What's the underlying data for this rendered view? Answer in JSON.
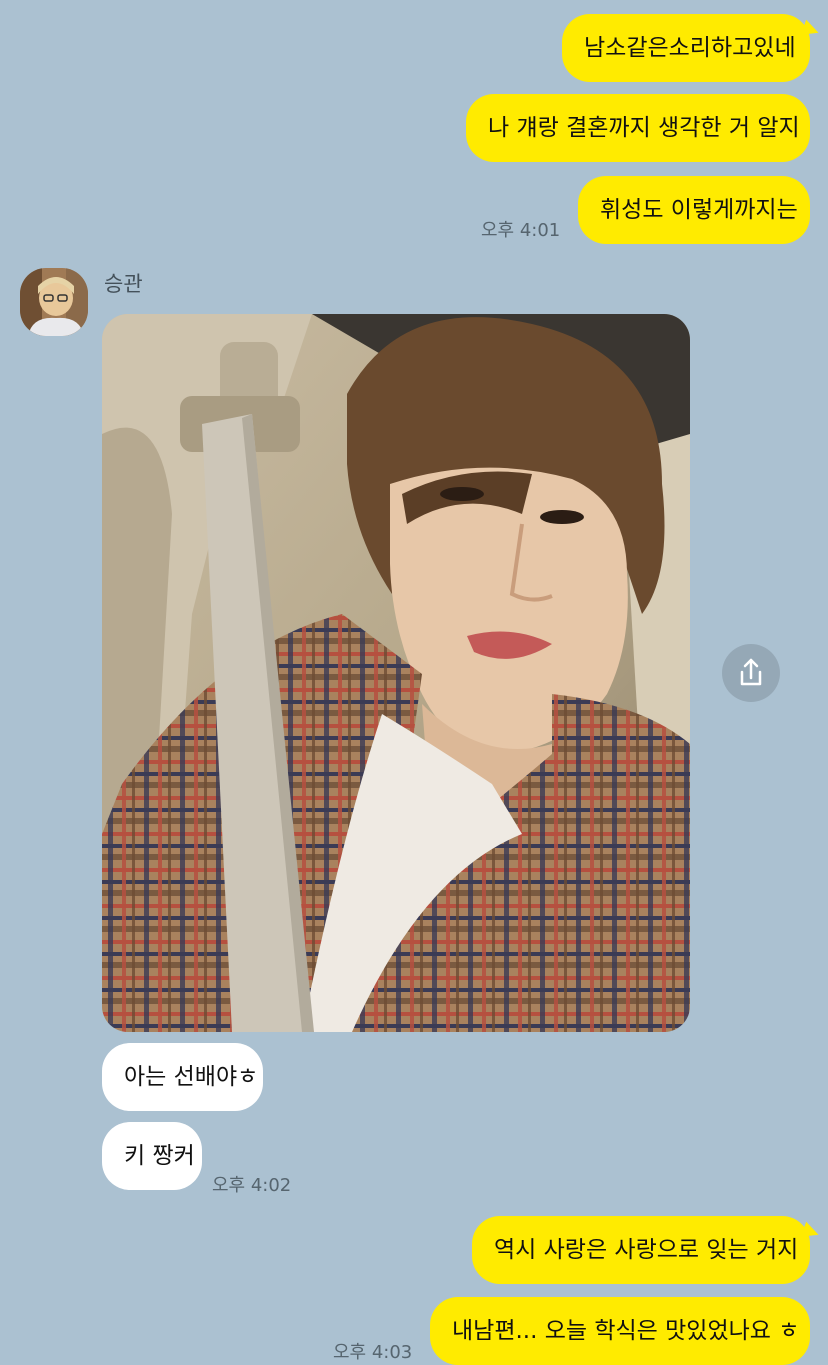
{
  "colors": {
    "background": "#abc1d1",
    "my_bubble": "#ffeb00",
    "other_bubble": "#ffffff",
    "timestamp": "#56656f"
  },
  "messages_top": [
    {
      "text": "남소같은소리하고있네"
    },
    {
      "text": "나 걔랑 결혼까지 생각한 거 알지"
    },
    {
      "text": "휘성도 이렇게까지는"
    }
  ],
  "time_1": "오후 4:01",
  "sender": {
    "name": "승관",
    "avatar_icon": "profile-photo"
  },
  "photo_message": {
    "image": "selfie-photo-in-car",
    "share_icon": "share-icon"
  },
  "messages_other": [
    {
      "text": "아는 선배야ㅎ"
    },
    {
      "text": "키 짱커"
    }
  ],
  "time_2": "오후 4:02",
  "messages_bottom": [
    {
      "text": "역시 사랑은 사랑으로 잊는 거지"
    },
    {
      "text": "내남편... 오늘 학식은 맛있었나요 ㅎ"
    }
  ],
  "time_3": "오후 4:03"
}
